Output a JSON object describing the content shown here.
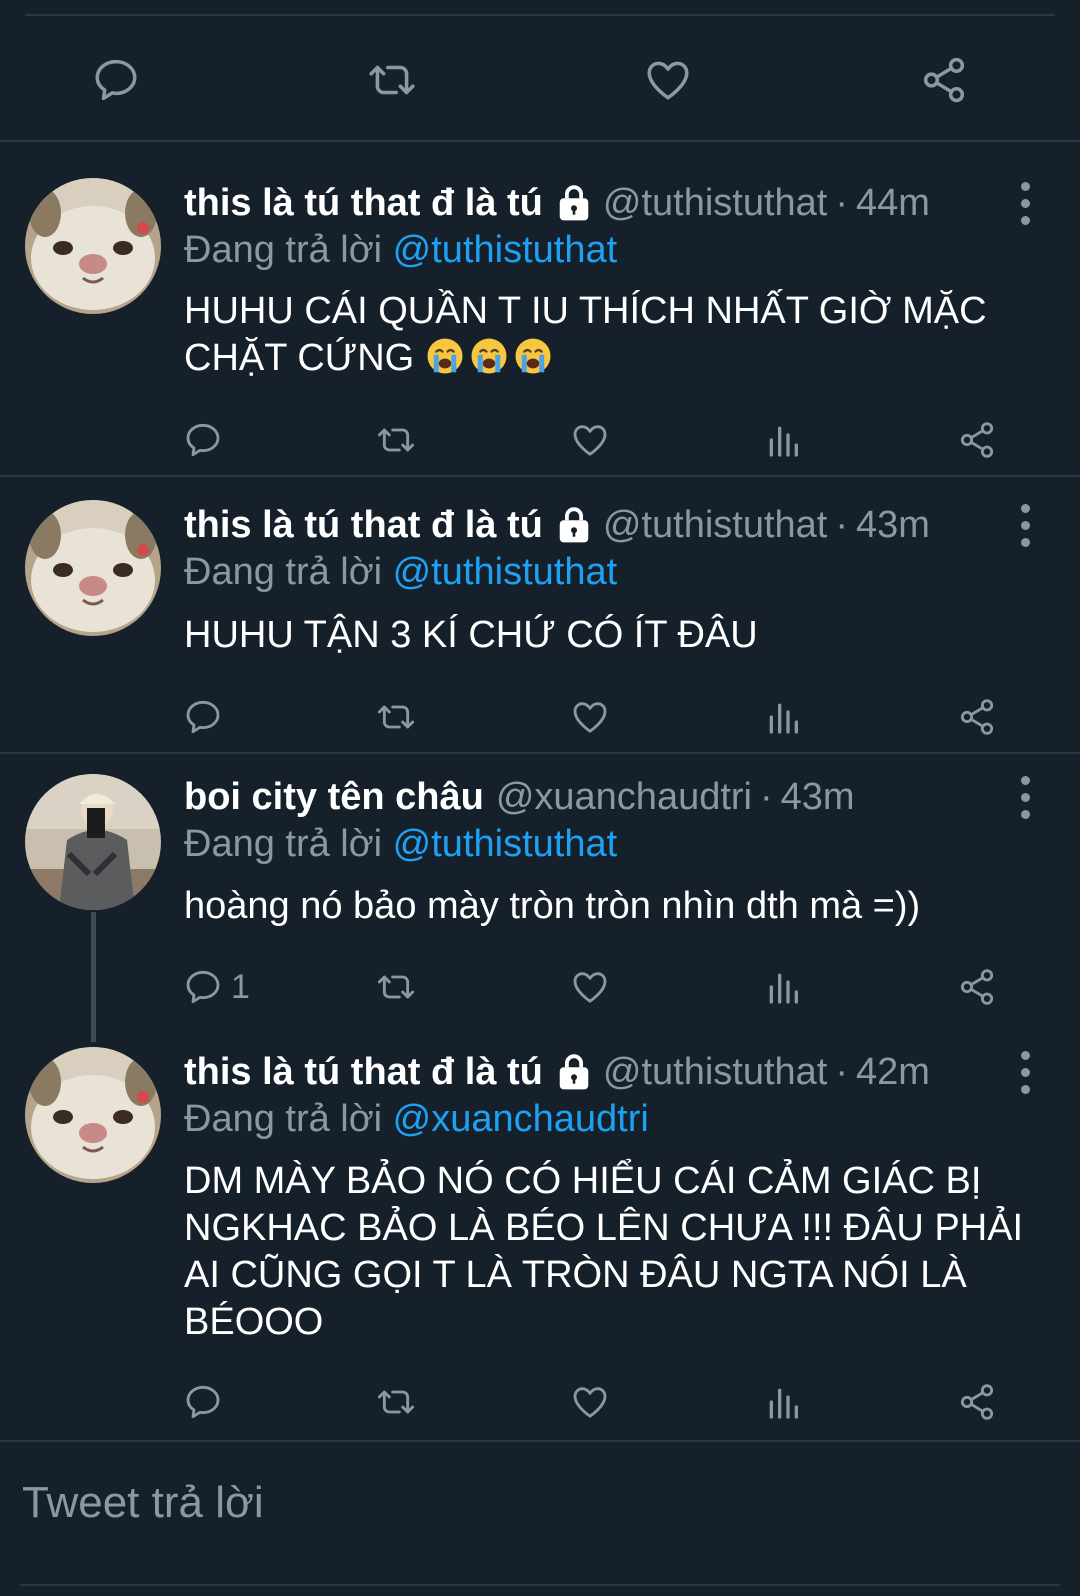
{
  "main_tweet_actions": {
    "icons": [
      "reply-icon",
      "retweet-icon",
      "like-icon",
      "share-icon"
    ]
  },
  "tweets": [
    {
      "name": "this là tú that đ là tú",
      "protected": true,
      "handle": "@tuthistuthat",
      "dot": "·",
      "time": "44m",
      "reply_prefix": "Đang trả lời",
      "reply_to": "@tuthistuthat",
      "text": "HUHU CÁI QUẦN T IU THÍCH NHẤT GIỜ MẶC CHẶT CỨNG",
      "emoji": [
        "loudly-crying-face",
        "loudly-crying-face",
        "loudly-crying-face"
      ],
      "reply_count": ""
    },
    {
      "name": "this là tú that đ là tú",
      "protected": true,
      "handle": "@tuthistuthat",
      "dot": "·",
      "time": "43m",
      "reply_prefix": "Đang trả lời",
      "reply_to": "@tuthistuthat",
      "text": "HUHU TẬN 3 KÍ CHỨ CÓ ÍT ĐÂU",
      "reply_count": ""
    },
    {
      "name": "boi city tên châu",
      "protected": false,
      "handle": "@xuanchaudtri",
      "dot": "·",
      "time": "43m",
      "reply_prefix": "Đang trả lời",
      "reply_to": "@tuthistuthat",
      "text": "hoàng nó bảo mày tròn tròn nhìn dth mà =))",
      "reply_count": "1"
    },
    {
      "name": "this là tú that đ là tú",
      "protected": true,
      "handle": "@tuthistuthat",
      "dot": "·",
      "time": "42m",
      "reply_prefix": "Đang trả lời",
      "reply_to": "@xuanchaudtri",
      "text_lines": [
        "DM MÀY BẢO NÓ CÓ HIỂU CÁI CẢM GIÁC BỊ",
        "NGKHAC BẢO LÀ BÉO LÊN CHƯA !!! ĐÂU PHẢI",
        "AI CŨNG GỌI T LÀ TRÒN ĐÂU NGTA NÓI LÀ",
        "BÉOOO"
      ],
      "reply_count": ""
    }
  ],
  "compose": {
    "placeholder": "Tweet trả lời"
  },
  "colors": {
    "background": "#15202b",
    "separator": "#2a3642",
    "muted": "#8899a6",
    "link": "#1da1f2"
  }
}
